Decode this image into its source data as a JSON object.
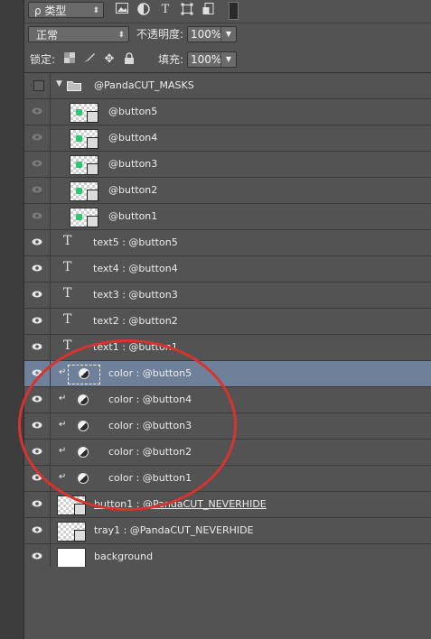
{
  "filter": {
    "kind_label": "ρ 类型",
    "icons": [
      "image-filter-icon",
      "adjustment-filter-icon",
      "type-filter-icon",
      "shape-filter-icon",
      "smartobject-filter-icon",
      "filter-toggle-icon"
    ]
  },
  "blend": {
    "mode": "正常",
    "opacity_label": "不透明度:",
    "opacity": "100%"
  },
  "lock": {
    "label": "锁定:",
    "icons": [
      "lock-transparency-icon",
      "lock-paint-icon",
      "lock-move-icon",
      "lock-all-icon"
    ],
    "fill_label": "填充:",
    "fill": "100%"
  },
  "selection_color": "#6f809a",
  "annotation_color": "#d8332e",
  "layers": [
    {
      "name": "@PandaCUT_MASKS",
      "type": "group",
      "visible": false
    },
    {
      "name": "@button5",
      "type": "masked",
      "visible": false
    },
    {
      "name": "@button4",
      "type": "masked",
      "visible": false
    },
    {
      "name": "@button3",
      "type": "masked",
      "visible": false
    },
    {
      "name": "@button2",
      "type": "masked",
      "visible": false
    },
    {
      "name": "@button1",
      "type": "masked",
      "visible": false
    },
    {
      "name": "text5 : @button5",
      "type": "text",
      "visible": true
    },
    {
      "name": "text4 : @button4",
      "type": "text",
      "visible": true
    },
    {
      "name": "text3 : @button3",
      "type": "text",
      "visible": true
    },
    {
      "name": "text2 : @button2",
      "type": "text",
      "visible": true
    },
    {
      "name": "text1 : @button1",
      "type": "text",
      "visible": true
    },
    {
      "name": "color : @button5",
      "type": "adjustment",
      "visible": true,
      "selected": true
    },
    {
      "name": "color : @button4",
      "type": "adjustment",
      "visible": true
    },
    {
      "name": "color : @button3",
      "type": "adjustment",
      "visible": true
    },
    {
      "name": "color : @button2",
      "type": "adjustment",
      "visible": true
    },
    {
      "name": "color : @button1",
      "type": "adjustment",
      "visible": true
    },
    {
      "name": "button1 : @PandaCUT_NEVERHIDE",
      "type": "image",
      "visible": true
    },
    {
      "name": "tray1 : @PandaCUT_NEVERHIDE",
      "type": "image",
      "visible": true
    },
    {
      "name": "background",
      "type": "background",
      "visible": true
    }
  ]
}
